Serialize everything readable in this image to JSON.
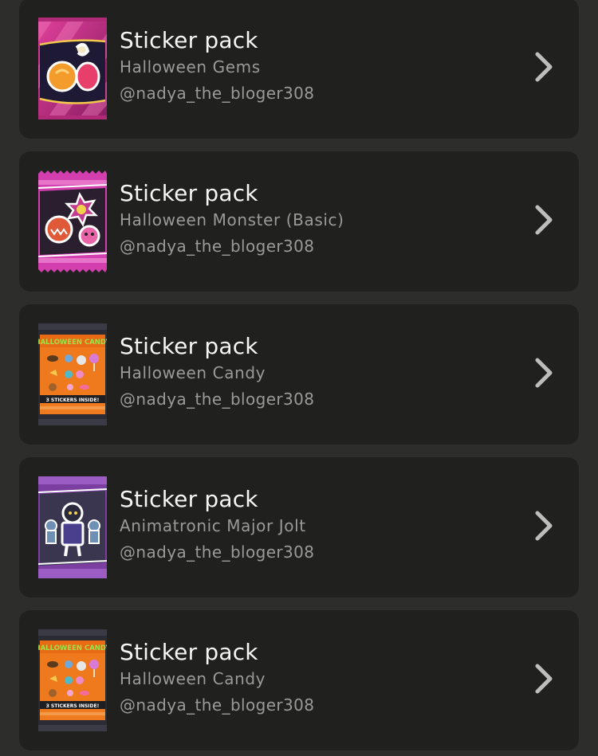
{
  "items": [
    {
      "title": "Sticker pack",
      "subtitle": "Halloween Gems",
      "author": "@nadya_the_bloger308",
      "pack_icon": "halloween-gems-pack-icon",
      "chevron_icon": "chevron-right-icon"
    },
    {
      "title": "Sticker pack",
      "subtitle": "Halloween Monster (Basic)",
      "author": "@nadya_the_bloger308",
      "pack_icon": "halloween-monster-pack-icon",
      "chevron_icon": "chevron-right-icon"
    },
    {
      "title": "Sticker pack",
      "subtitle": "Halloween Candy",
      "author": "@nadya_the_bloger308",
      "pack_icon": "halloween-candy-pack-icon",
      "pack_banner": "HALLOWEEN CANDY",
      "pack_footer": "3 STICKERS INSIDE!",
      "chevron_icon": "chevron-right-icon"
    },
    {
      "title": "Sticker pack",
      "subtitle": "Animatronic Major Jolt",
      "author": "@nadya_the_bloger308",
      "pack_icon": "animatronic-pack-icon",
      "chevron_icon": "chevron-right-icon"
    },
    {
      "title": "Sticker pack",
      "subtitle": "Halloween Candy",
      "author": "@nadya_the_bloger308",
      "pack_icon": "halloween-candy-pack-icon",
      "pack_banner": "HALLOWEEN CANDY",
      "pack_footer": "3 STICKERS INSIDE!",
      "chevron_icon": "chevron-right-icon"
    }
  ],
  "colors": {
    "background": "#2d2d2b",
    "card": "#20201e",
    "title": "#f5f5f5",
    "secondary_text": "#9a9a98",
    "chevron": "#bdbdbd"
  }
}
